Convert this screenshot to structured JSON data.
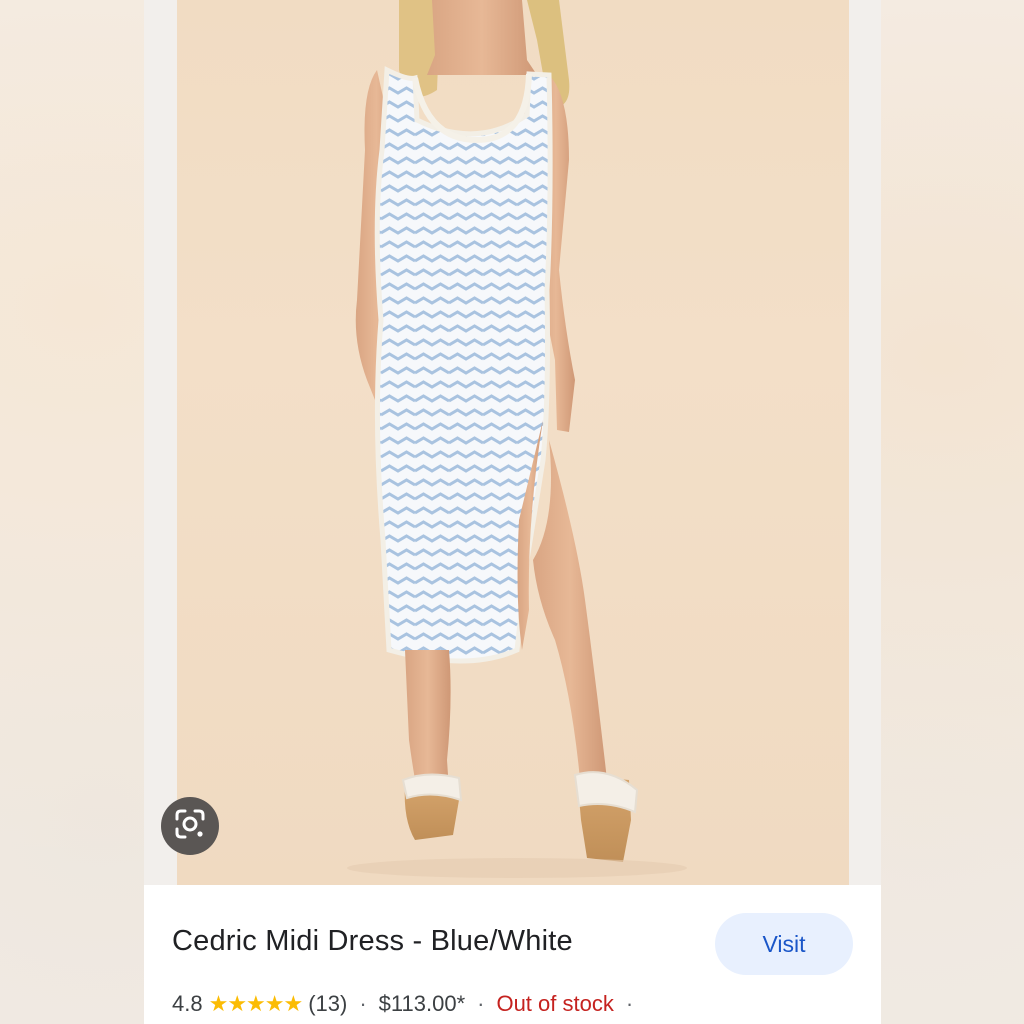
{
  "product": {
    "title": "Cedric Midi Dress - Blue/White",
    "rating": "4.8",
    "stars": "★★★★★",
    "review_count": "(13)",
    "price": "$113.00*",
    "stock_status": "Out of stock",
    "separator": "·"
  },
  "actions": {
    "visit_label": "Visit"
  },
  "icons": {
    "lens": "google-lens-icon"
  },
  "colors": {
    "visit_bg": "#e8f0fe",
    "visit_text": "#1a56c8",
    "out_of_stock": "#c5221f",
    "star": "#fbbc04"
  }
}
